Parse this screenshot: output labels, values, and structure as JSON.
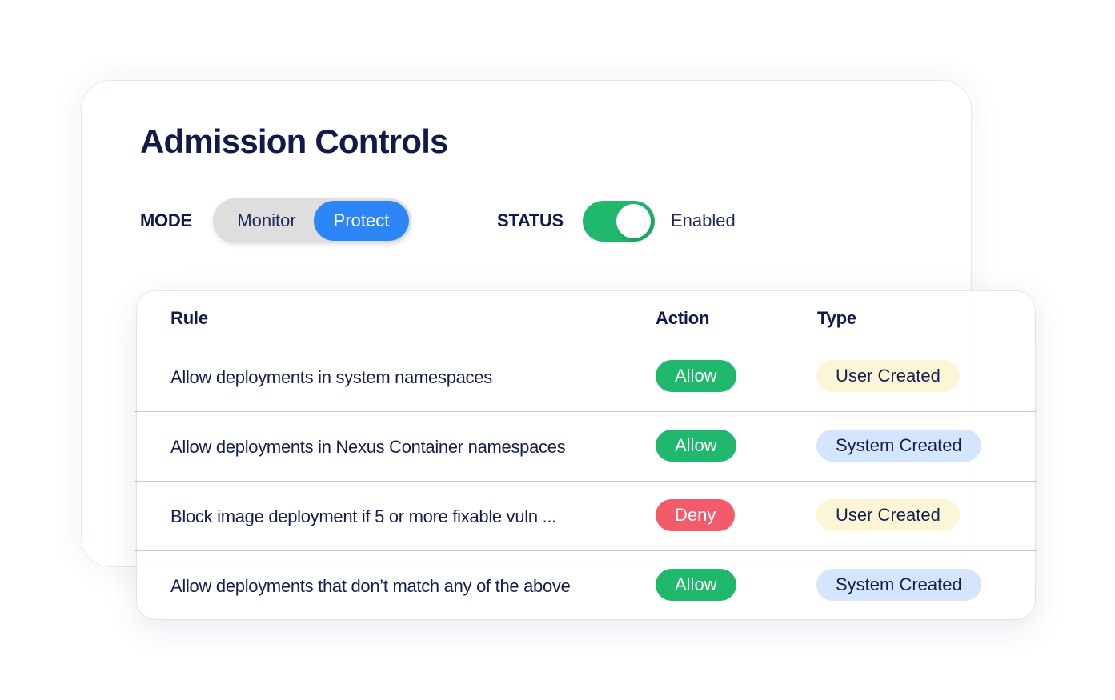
{
  "header": {
    "title": "Admission Controls"
  },
  "mode": {
    "label": "MODE",
    "options": [
      "Monitor",
      "Protect"
    ],
    "selected": "Protect"
  },
  "status": {
    "label": "STATUS",
    "enabled": true,
    "value": "Enabled"
  },
  "colors": {
    "accent_blue": "#2d86f5",
    "toggle_on": "#1fb86d",
    "allow": "#1fb86d",
    "deny": "#f35b6b",
    "user_created_bg": "#fdf6d6",
    "system_created_bg": "#d5e5fd",
    "text_dark": "#121a4a"
  },
  "table": {
    "columns": [
      "Rule",
      "Action",
      "Type"
    ],
    "rows": [
      {
        "rule": "Allow deployments in system namespaces",
        "action": "Allow",
        "type": "User Created"
      },
      {
        "rule": "Allow deployments in Nexus Container namespaces",
        "action": "Allow",
        "type": "System Created"
      },
      {
        "rule": "Block image deployment if 5 or more fixable vuln ...",
        "action": "Deny",
        "type": "User Created"
      },
      {
        "rule": "Allow deployments that don’t match any of the above",
        "action": "Allow",
        "type": "System Created"
      }
    ]
  }
}
